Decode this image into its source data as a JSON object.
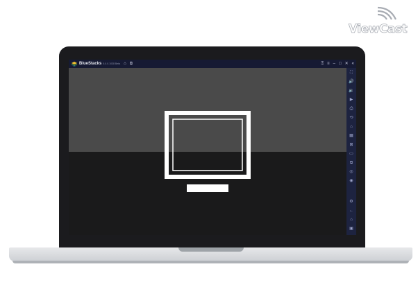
{
  "brand": {
    "logo_text": "ViewCast"
  },
  "window": {
    "title": "BlueStacks",
    "version": "5.0.0.1038 Beta",
    "title_buttons": [
      {
        "name": "help-icon",
        "glyph": "⍰"
      },
      {
        "name": "menu-icon",
        "glyph": "≡"
      },
      {
        "name": "minimize-icon",
        "glyph": "–"
      },
      {
        "name": "maximize-icon",
        "glyph": "□"
      },
      {
        "name": "close-icon",
        "glyph": "✕"
      },
      {
        "name": "collapse-sidebar-icon",
        "glyph": "«"
      }
    ]
  },
  "sidebar": {
    "items": [
      {
        "name": "fullscreen-icon",
        "glyph": "⛶"
      },
      {
        "name": "volume-up-icon",
        "glyph": "🔊"
      },
      {
        "name": "volume-down-icon",
        "glyph": "🔉"
      },
      {
        "name": "media-manager-icon",
        "glyph": "▶"
      },
      {
        "name": "screenshot-icon",
        "glyph": "⎙"
      },
      {
        "name": "rotate-icon",
        "glyph": "⟲"
      },
      {
        "name": "shake-icon",
        "glyph": "⌂"
      },
      {
        "name": "gamepad-icon",
        "glyph": "▦"
      },
      {
        "name": "macro-icon",
        "glyph": "⊠"
      },
      {
        "name": "folder-icon",
        "glyph": "▭"
      },
      {
        "name": "multi-instance-icon",
        "glyph": "⧉"
      },
      {
        "name": "location-icon",
        "glyph": "◎"
      },
      {
        "name": "eco-mode-icon",
        "glyph": "◉"
      },
      {
        "name": "settings-icon",
        "glyph": "⚙"
      },
      {
        "name": "back-icon",
        "glyph": "←"
      },
      {
        "name": "home-icon",
        "glyph": "⌂"
      },
      {
        "name": "recent-apps-icon",
        "glyph": "▣"
      }
    ]
  },
  "colors": {
    "titlebar": "#161a33",
    "sidebar": "#1d2340",
    "screen_top": "#4a4a4a",
    "screen_bottom": "#1a1a1b"
  }
}
